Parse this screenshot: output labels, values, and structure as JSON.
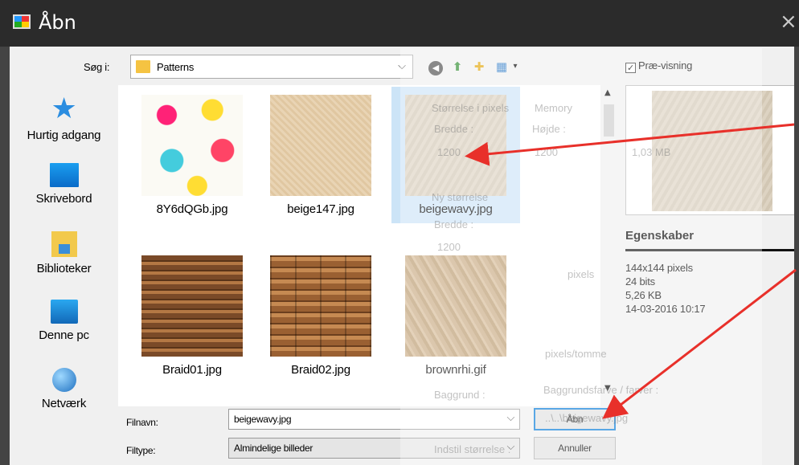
{
  "window": {
    "title": "Åbn",
    "close_glyph": "×"
  },
  "look_in": {
    "label": "Søg i:",
    "value": "Patterns",
    "folder_icon": "folder-icon"
  },
  "toolbar": {
    "back_glyph": "◀",
    "up_glyph": "⬆",
    "new_folder_glyph": "✚",
    "view_glyph": "▦",
    "view_drop_glyph": "▾"
  },
  "preview": {
    "label": "Præ-visning",
    "checked": "✓"
  },
  "places": [
    {
      "label": "Hurtig adgang",
      "icon": "star-icon"
    },
    {
      "label": "Skrivebord",
      "icon": "desktop-icon"
    },
    {
      "label": "Biblioteker",
      "icon": "libraries-icon"
    },
    {
      "label": "Denne pc",
      "icon": "computer-icon"
    },
    {
      "label": "Netværk",
      "icon": "network-icon"
    }
  ],
  "files": [
    {
      "name": "8Y6dQGb.jpg"
    },
    {
      "name": "beige147.jpg"
    },
    {
      "name": "beigewavy.jpg",
      "selected": true
    },
    {
      "name": "Braid01.jpg"
    },
    {
      "name": "Braid02.jpg"
    },
    {
      "name": "brownrhi.gif"
    }
  ],
  "form": {
    "filename_label": "Filnavn:",
    "filename_value": "beigewavy.jpg",
    "filetype_label": "Filtype:",
    "filetype_value": "Almindelige billeder",
    "chevron": "⌵",
    "open_label": "Åbn",
    "cancel_label": "Annuller"
  },
  "properties": {
    "title": "Egenskaber",
    "lines": [
      "144x144 pixels",
      "24 bits",
      "5,26 KB",
      "14-03-2016 10:17"
    ]
  },
  "background_ghost": {
    "size_header": "Størrelse i pixels",
    "memory": "Memory",
    "width_label": "Bredde :",
    "height_label": "Højde :",
    "width_value": "1200",
    "height_value": "1200",
    "memory_value": "1,03 MB",
    "new_size": "Ny størrelse",
    "new_width_label": "Bredde :",
    "new_width_value": "1200",
    "pixels": "pixels",
    "units": "pixels/tomme",
    "background": "Baggrund :",
    "background_check": "Baggrundsfarve / farver :",
    "bg_file": "..\\..\\beigewavy.jpg",
    "set_size": "Indstil størrelse :"
  },
  "annotation": {
    "arrow_color": "#e8302a"
  }
}
